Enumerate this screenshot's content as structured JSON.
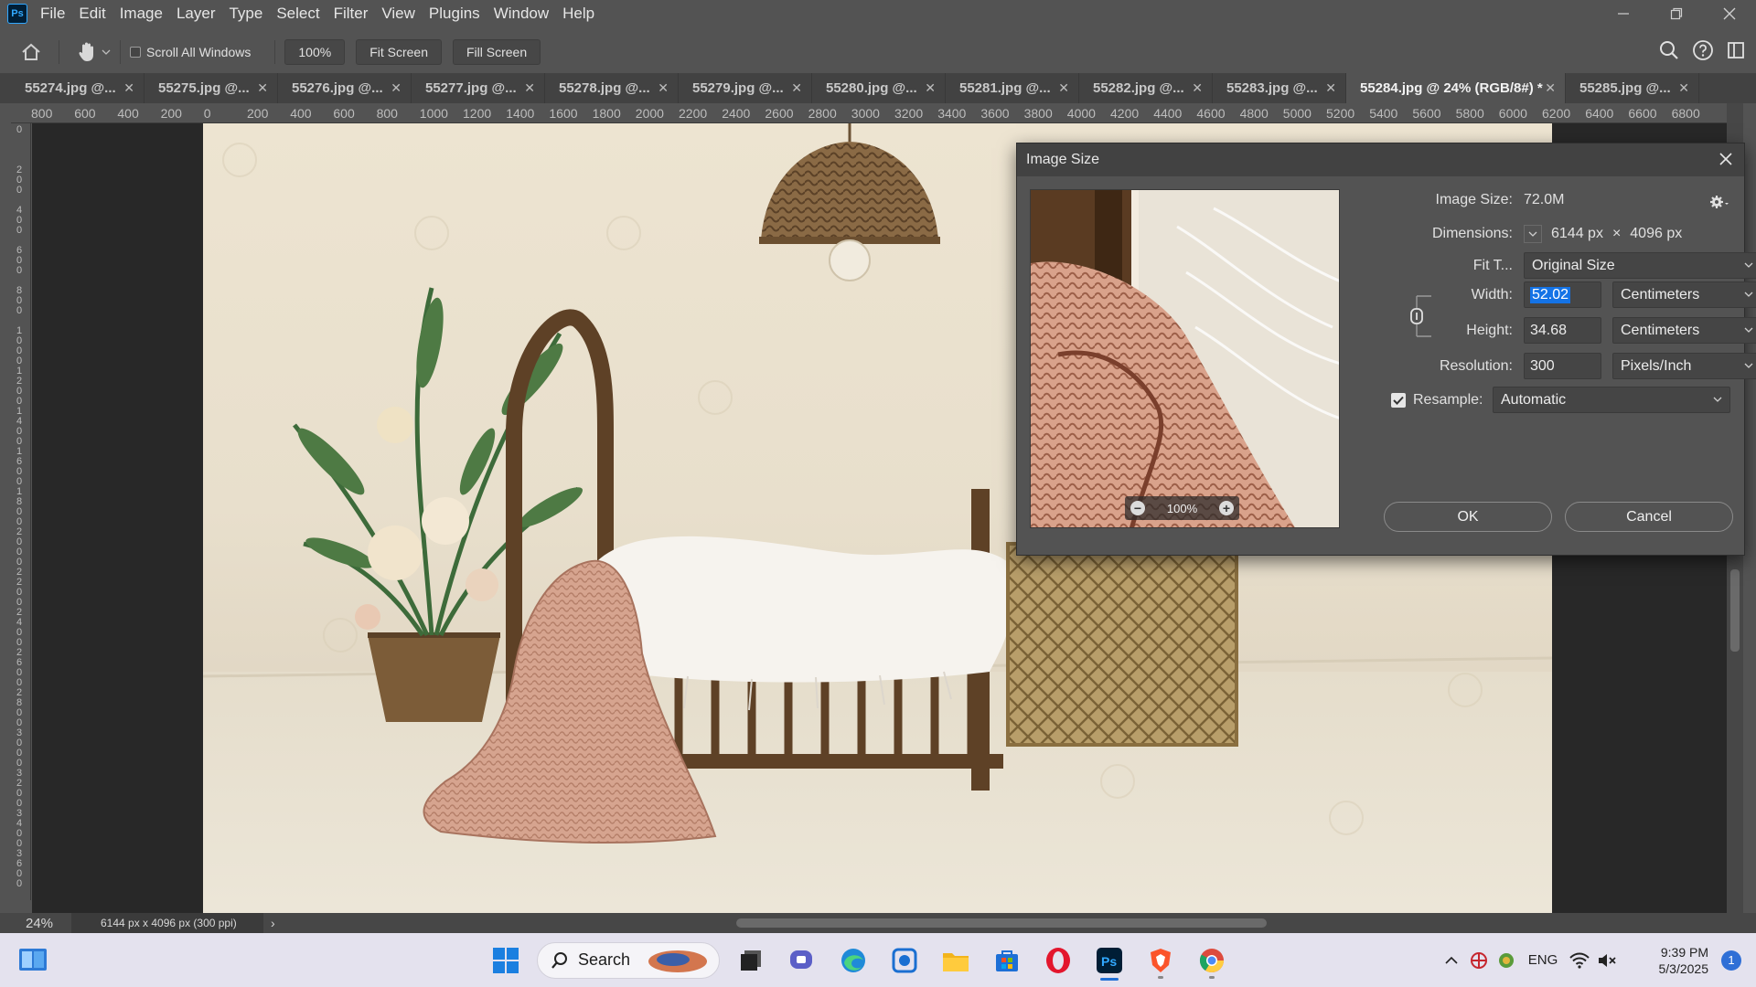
{
  "app": {
    "name": "Photoshop",
    "logo_text": "Ps"
  },
  "menu": [
    "File",
    "Edit",
    "Image",
    "Layer",
    "Type",
    "Select",
    "Filter",
    "View",
    "Plugins",
    "Window",
    "Help"
  ],
  "options_bar": {
    "scroll_all_windows_label": "Scroll All Windows",
    "scroll_all_windows_checked": false,
    "zoom_button": "100%",
    "fit_screen_button": "Fit Screen",
    "fill_screen_button": "Fill Screen"
  },
  "tabs": [
    {
      "label": "55274.jpg @...",
      "active": false
    },
    {
      "label": "55275.jpg @...",
      "active": false
    },
    {
      "label": "55276.jpg @...",
      "active": false
    },
    {
      "label": "55277.jpg @...",
      "active": false
    },
    {
      "label": "55278.jpg @...",
      "active": false
    },
    {
      "label": "55279.jpg @...",
      "active": false
    },
    {
      "label": "55280.jpg @...",
      "active": false
    },
    {
      "label": "55281.jpg @...",
      "active": false
    },
    {
      "label": "55282.jpg @...",
      "active": false
    },
    {
      "label": "55283.jpg @...",
      "active": false
    },
    {
      "label": "55284.jpg @ 24% (RGB/8#) *",
      "active": true
    },
    {
      "label": "55285.jpg @...",
      "active": false
    }
  ],
  "ruler_h_labels": [
    "800",
    "600",
    "400",
    "200",
    "0",
    "200",
    "400",
    "600",
    "800",
    "1000",
    "1200",
    "1400",
    "1600",
    "1800",
    "2000",
    "2200",
    "2400",
    "2600",
    "2800",
    "3000",
    "3200",
    "3400",
    "3600",
    "3800",
    "4000",
    "4200",
    "4400",
    "4600",
    "4800",
    "5000",
    "5200",
    "5400",
    "5600",
    "5800",
    "6000",
    "6200",
    "6400",
    "6600",
    "6800"
  ],
  "ruler_v_labels": [
    "0",
    "2 0 0",
    "4 0 0",
    "6 0 0",
    "8 0 0",
    "1 0 0 0",
    "1 2 0 0",
    "1 4 0 0",
    "1 6 0 0",
    "1 8 0 0",
    "2 0 0 0",
    "2 2 0 0",
    "2 4 0 0",
    "2 6 0 0",
    "2 8 0 0",
    "3 0 0 0",
    "3 2 0 0",
    "3 4 0 0",
    "3 6 0 0"
  ],
  "status_bar": {
    "zoom": "24%",
    "doc_info": "6144 px x 4096 px (300 ppi)"
  },
  "image_size_dialog": {
    "title": "Image Size",
    "preview_zoom": "100%",
    "image_size_label": "Image Size:",
    "image_size_value": "72.0M",
    "dimensions_label": "Dimensions:",
    "dimensions_width": "6144 px",
    "dimensions_x": "×",
    "dimensions_height": "4096 px",
    "fit_to_label": "Fit T...",
    "fit_to_value": "Original Size",
    "width_label": "Width:",
    "width_value": "52.02",
    "width_unit": "Centimeters",
    "height_label": "Height:",
    "height_value": "34.68",
    "height_unit": "Centimeters",
    "resolution_label": "Resolution:",
    "resolution_value": "300",
    "resolution_unit": "Pixels/Inch",
    "resample_label": "Resample:",
    "resample_checked": true,
    "resample_value": "Automatic",
    "ok_button": "OK",
    "cancel_button": "Cancel"
  },
  "taskbar": {
    "search_label": "Search",
    "language": "ENG",
    "time": "9:39 PM",
    "date": "5/3/2025",
    "notification_count": "1"
  }
}
